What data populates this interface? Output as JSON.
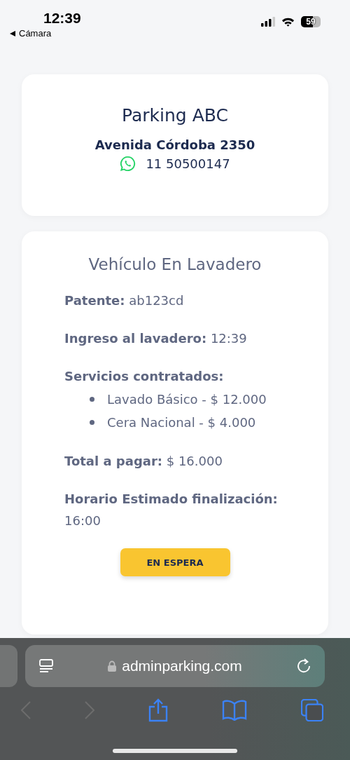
{
  "status_bar": {
    "time": "12:39",
    "back_label": "Cámara",
    "battery": "59"
  },
  "business": {
    "name": "Parking ABC",
    "address": "Avenida Córdoba 2350",
    "phone": "11 50500147"
  },
  "vehicle": {
    "title": "Vehículo En Lavadero",
    "details": [
      {
        "kind": "line",
        "label": "Patente:",
        "value": "ab123cd"
      },
      {
        "kind": "line",
        "label": "Ingreso al lavadero:",
        "value": "12:39"
      },
      {
        "kind": "list",
        "label": "Servicios contratados:",
        "items": [
          "Lavado Básico - $ 12.000",
          "Cera Nacional - $ 4.000"
        ]
      },
      {
        "kind": "line",
        "label": "Total a pagar:",
        "value": "$ 16.000"
      },
      {
        "kind": "line",
        "label": "Horario Estimado finalización:",
        "value": "16:00"
      }
    ],
    "status_button": "EN ESPERA"
  },
  "browser": {
    "url": "adminparking.com",
    "back_disabled": true,
    "forward_disabled": true
  }
}
